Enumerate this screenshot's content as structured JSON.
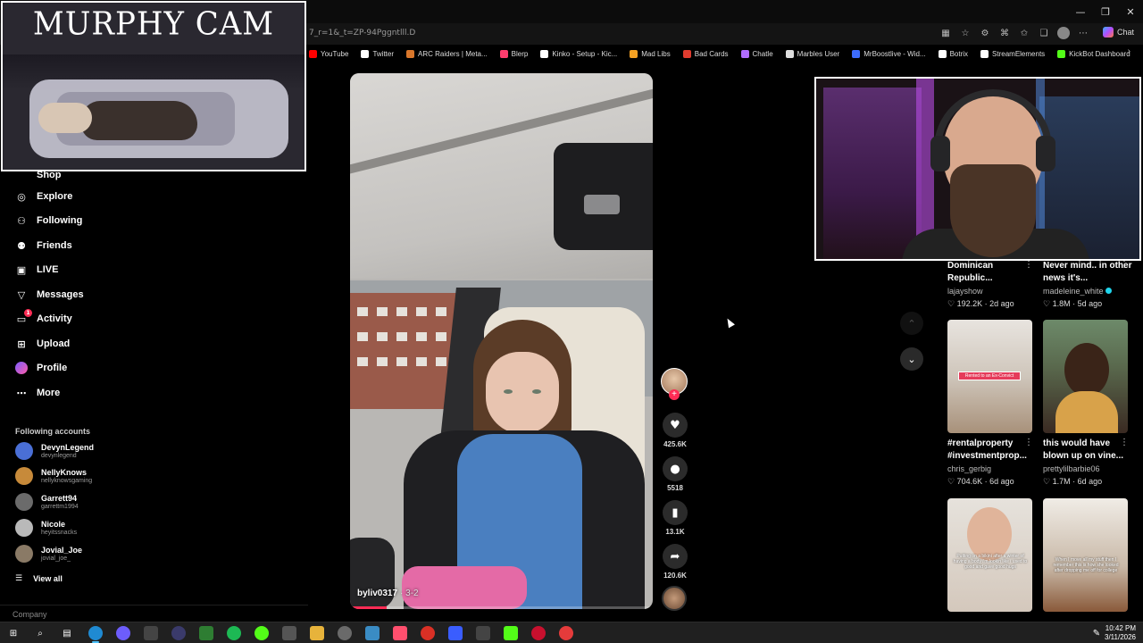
{
  "overlay": {
    "murphy_cam_title": "MURPHY CAM"
  },
  "browser": {
    "url": "7_r=1&_t=ZP-94Pggntlll.D",
    "chat_label": "Chat",
    "bookmarks": [
      {
        "label": "YouTube",
        "color": "#ff0000"
      },
      {
        "label": "Twitter",
        "color": "#ffffff"
      },
      {
        "label": "ARC Raiders | Meta...",
        "color": "#d9772b"
      },
      {
        "label": "Blerp",
        "color": "#ff3d6e"
      },
      {
        "label": "Kinko - Setup - Kic...",
        "color": "#ffffff"
      },
      {
        "label": "Mad Libs",
        "color": "#f4a123"
      },
      {
        "label": "Bad Cards",
        "color": "#e03c2f"
      },
      {
        "label": "Chatle",
        "color": "#b06cff"
      },
      {
        "label": "Marbles User",
        "color": "#dddddd"
      },
      {
        "label": "MrBoostlive - Wid...",
        "color": "#3d6dff"
      },
      {
        "label": "Botrix",
        "color": "#ffffff"
      },
      {
        "label": "StreamElements",
        "color": "#ffffff"
      },
      {
        "label": "KickBot Dashboard",
        "color": "#53fc18"
      }
    ]
  },
  "sidebar": {
    "partial_item": "Shop",
    "items": [
      {
        "label": "Explore",
        "icon": "compass-icon"
      },
      {
        "label": "Following",
        "icon": "person-plus-icon"
      },
      {
        "label": "Friends",
        "icon": "friends-icon"
      },
      {
        "label": "LIVE",
        "icon": "live-icon"
      },
      {
        "label": "Messages",
        "icon": "messages-icon"
      },
      {
        "label": "Activity",
        "icon": "activity-icon",
        "badge": "1"
      },
      {
        "label": "Upload",
        "icon": "upload-icon"
      },
      {
        "label": "Profile",
        "icon": "profile-avatar"
      },
      {
        "label": "More",
        "icon": "more-icon"
      }
    ],
    "following_header": "Following accounts",
    "following": [
      {
        "name": "DevynLegend",
        "handle": "devynlegend",
        "color": "#4a6fd6"
      },
      {
        "name": "NellyKnows",
        "handle": "nellyknowsgaming",
        "color": "#c78a3a"
      },
      {
        "name": "Garrett94",
        "handle": "garrettm1994",
        "color": "#6b6b6b"
      },
      {
        "name": "Nicole",
        "handle": "heyitssnacks",
        "color": "#b9b9b9"
      },
      {
        "name": "Jovial_Joe",
        "handle": "jovial_joe_",
        "color": "#8a7a66"
      }
    ],
    "view_all": "View all",
    "company": "Company"
  },
  "video": {
    "username": "byliv0317",
    "date": "3-2",
    "progress": 0.12
  },
  "actions": {
    "likes": "425.6K",
    "comments": "5518",
    "saves": "13.1K",
    "shares": "120.6K"
  },
  "feed": [
    {
      "title": "Dominican Republic...",
      "user": "lajayshow",
      "likes": "192.2K",
      "age": "2d ago",
      "verified": false
    },
    {
      "title": "Never mind.. in other news it's...",
      "user": "madeleine_white",
      "likes": "1.8M",
      "age": "5d ago",
      "verified": true
    },
    {
      "title": "#rentalproperty #investmentprop...",
      "user": "chris_gerbig",
      "likes": "704.6K",
      "age": "6d ago",
      "verified": false,
      "thumb_label": "Rented to an Ex-Convict"
    },
    {
      "title": "this would have blown up on vine...",
      "user": "prettylilbarbie06",
      "likes": "1.7M",
      "age": "6d ago",
      "verified": false
    },
    {
      "caption": "Putting on a bikini after a winter of having a body i'm lookin like i used to good and gave good hugs"
    },
    {
      "caption": "When I move all my stuff then I remember this is how she looked after dropping me off for college"
    }
  ],
  "taskbar": {
    "time": "10:42 PM",
    "date": "3/11/2026"
  }
}
